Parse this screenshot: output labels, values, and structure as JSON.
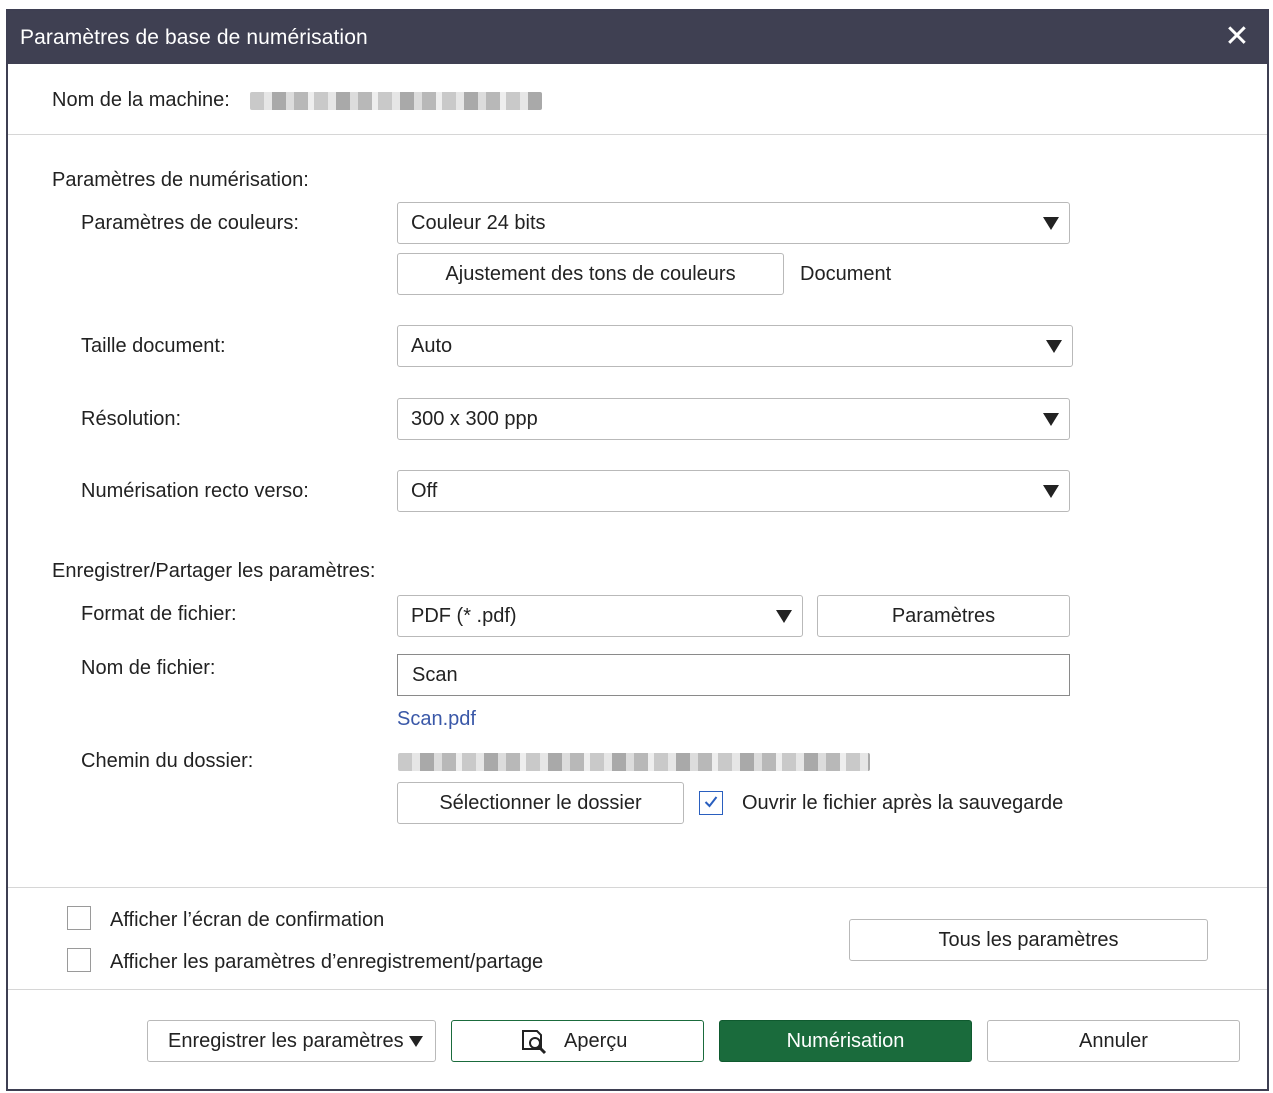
{
  "window": {
    "title": "Paramètres de base de numérisation",
    "close_icon": "close-icon"
  },
  "machine": {
    "label": "Nom de la machine:"
  },
  "scan_settings": {
    "title": "Paramètres de numérisation:",
    "color": {
      "label": "Paramètres de couleurs:",
      "value": "Couleur 24 bits"
    },
    "tone_button": "Ajustement des tons de couleurs",
    "tone_value": "Document",
    "size": {
      "label": "Taille document:",
      "value": "Auto"
    },
    "resolution": {
      "label": "Résolution:",
      "value": "300 x 300 ppp"
    },
    "duplex": {
      "label": "Numérisation recto verso:",
      "value": "Off"
    }
  },
  "save_settings": {
    "title": "Enregistrer/Partager les paramètres:",
    "format": {
      "label": "Format de fichier:",
      "value": "PDF (* .pdf)"
    },
    "params_button": "Paramètres",
    "filename": {
      "label": "Nom de fichier:",
      "value": "Scan",
      "preview": "Scan.pdf"
    },
    "folder": {
      "label": "Chemin du dossier:"
    },
    "select_folder_button": "Sélectionner le dossier",
    "open_after_save": {
      "label": "Ouvrir le fichier après la sauvegarde",
      "checked": true
    }
  },
  "options": {
    "show_confirm": {
      "label": "Afficher l’écran de confirmation",
      "checked": false
    },
    "show_save_settings": {
      "label": "Afficher les paramètres d’enregistrement/partage",
      "checked": false
    },
    "all_params_button": "Tous les paramètres"
  },
  "footer": {
    "save_params_button": "Enregistrer les paramètres",
    "preview_button": "Aperçu",
    "scan_button": "Numérisation",
    "cancel_button": "Annuler"
  },
  "colors": {
    "titlebar": "#3f4052",
    "primary": "#1a6b3c",
    "link": "#3a58a8"
  }
}
